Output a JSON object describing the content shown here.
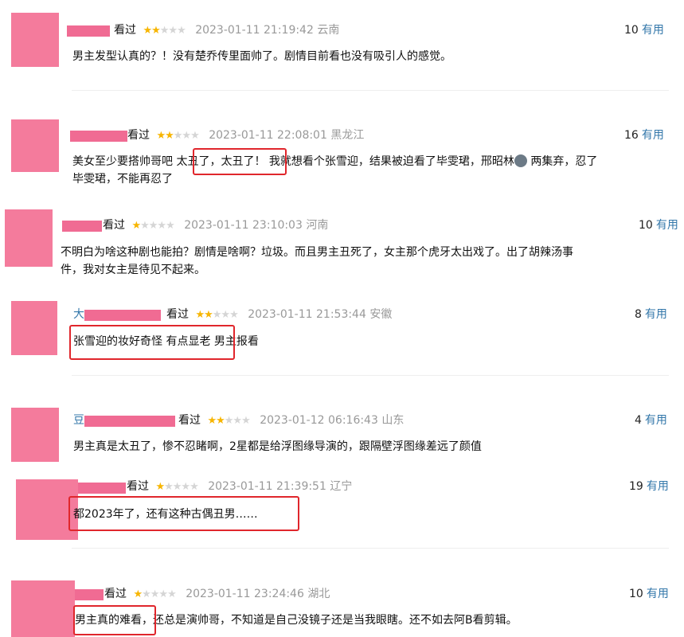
{
  "comments": [
    {
      "seen": "看过",
      "stars": 2,
      "time": "2023-01-11 21:19:42",
      "loc": "云南",
      "count": "10",
      "useful": "有用",
      "lines": [
        "男主发型认真的？！没有楚乔传里面帅了。剧情目前看也没有吸引人的感觉。"
      ]
    },
    {
      "seen": "看过",
      "stars": 2,
      "time": "2023-01-11 22:08:01",
      "loc": "黑龙江",
      "count": "16",
      "useful": "有用",
      "line1a": "美女至少要搭帅哥吧 ",
      "line1b": "太丑了，太丑了！",
      "line1c": "我就想看个张雪迎，结果被迫看了毕雯珺，邢昭林",
      "line1d": " 两集弃，忍了",
      "line2": "毕雯珺，不能再忍了",
      "emoji": "weary-face-emoji"
    },
    {
      "seen": "看过",
      "stars": 1,
      "time": "2023-01-11 23:10:03",
      "loc": "河南",
      "count": "10",
      "useful": "有用",
      "lines": [
        "不明白为啥这种剧也能拍？剧情是啥啊？垃圾。而且男主丑死了，女主那个虎牙太出戏了。出了胡辣汤事",
        "件，我对女主是待见不起来。"
      ]
    },
    {
      "seen": "看过",
      "stars": 2,
      "time": "2023-01-11 21:53:44",
      "loc": "安徽",
      "count": "8",
      "useful": "有用",
      "name": "大",
      "line1a": "张雪迎的妆好奇怪 有点显老",
      "line1b": " 男主报看"
    },
    {
      "seen": "看过",
      "stars": 2,
      "time": "2023-01-12 06:16:43",
      "loc": "山东",
      "count": "4",
      "useful": "有用",
      "name": "豆",
      "lines": [
        "男主真是太丑了，惨不忍睹啊，2星都是给浮图缘导演的，跟隔壁浮图缘差远了颜值"
      ]
    },
    {
      "seen": "看过",
      "stars": 1,
      "time": "2023-01-11 21:39:51",
      "loc": "辽宁",
      "count": "19",
      "useful": "有用",
      "lines": [
        "都2023年了，还有这种古偶丑男……"
      ]
    },
    {
      "seen": "看过",
      "stars": 1,
      "time": "2023-01-11 23:24:46",
      "loc": "湖北",
      "count": "10",
      "useful": "有用",
      "line1a": "男主真的难看",
      "line1b": "，还总是演帅哥，不知道是自己没镜子还是当我眼瞎。还不如去阿B看剪辑。"
    }
  ]
}
